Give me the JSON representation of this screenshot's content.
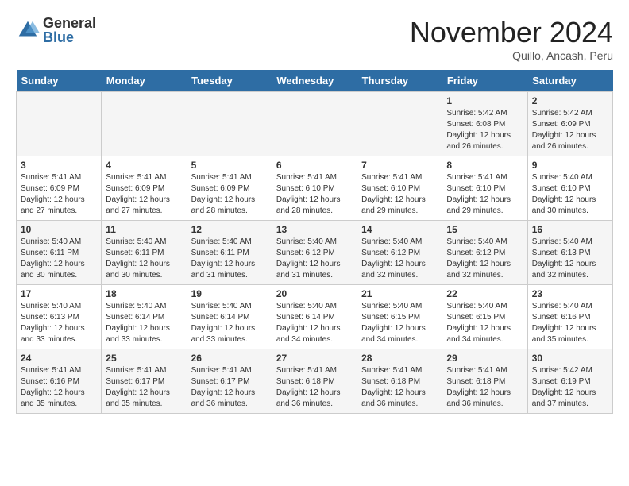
{
  "header": {
    "logo_general": "General",
    "logo_blue": "Blue",
    "title": "November 2024",
    "subtitle": "Quillo, Ancash, Peru"
  },
  "days_of_week": [
    "Sunday",
    "Monday",
    "Tuesday",
    "Wednesday",
    "Thursday",
    "Friday",
    "Saturday"
  ],
  "weeks": [
    [
      {
        "day": "",
        "info": ""
      },
      {
        "day": "",
        "info": ""
      },
      {
        "day": "",
        "info": ""
      },
      {
        "day": "",
        "info": ""
      },
      {
        "day": "",
        "info": ""
      },
      {
        "day": "1",
        "info": "Sunrise: 5:42 AM\nSunset: 6:08 PM\nDaylight: 12 hours and 26 minutes."
      },
      {
        "day": "2",
        "info": "Sunrise: 5:42 AM\nSunset: 6:09 PM\nDaylight: 12 hours and 26 minutes."
      }
    ],
    [
      {
        "day": "3",
        "info": "Sunrise: 5:41 AM\nSunset: 6:09 PM\nDaylight: 12 hours and 27 minutes."
      },
      {
        "day": "4",
        "info": "Sunrise: 5:41 AM\nSunset: 6:09 PM\nDaylight: 12 hours and 27 minutes."
      },
      {
        "day": "5",
        "info": "Sunrise: 5:41 AM\nSunset: 6:09 PM\nDaylight: 12 hours and 28 minutes."
      },
      {
        "day": "6",
        "info": "Sunrise: 5:41 AM\nSunset: 6:10 PM\nDaylight: 12 hours and 28 minutes."
      },
      {
        "day": "7",
        "info": "Sunrise: 5:41 AM\nSunset: 6:10 PM\nDaylight: 12 hours and 29 minutes."
      },
      {
        "day": "8",
        "info": "Sunrise: 5:41 AM\nSunset: 6:10 PM\nDaylight: 12 hours and 29 minutes."
      },
      {
        "day": "9",
        "info": "Sunrise: 5:40 AM\nSunset: 6:10 PM\nDaylight: 12 hours and 30 minutes."
      }
    ],
    [
      {
        "day": "10",
        "info": "Sunrise: 5:40 AM\nSunset: 6:11 PM\nDaylight: 12 hours and 30 minutes."
      },
      {
        "day": "11",
        "info": "Sunrise: 5:40 AM\nSunset: 6:11 PM\nDaylight: 12 hours and 30 minutes."
      },
      {
        "day": "12",
        "info": "Sunrise: 5:40 AM\nSunset: 6:11 PM\nDaylight: 12 hours and 31 minutes."
      },
      {
        "day": "13",
        "info": "Sunrise: 5:40 AM\nSunset: 6:12 PM\nDaylight: 12 hours and 31 minutes."
      },
      {
        "day": "14",
        "info": "Sunrise: 5:40 AM\nSunset: 6:12 PM\nDaylight: 12 hours and 32 minutes."
      },
      {
        "day": "15",
        "info": "Sunrise: 5:40 AM\nSunset: 6:12 PM\nDaylight: 12 hours and 32 minutes."
      },
      {
        "day": "16",
        "info": "Sunrise: 5:40 AM\nSunset: 6:13 PM\nDaylight: 12 hours and 32 minutes."
      }
    ],
    [
      {
        "day": "17",
        "info": "Sunrise: 5:40 AM\nSunset: 6:13 PM\nDaylight: 12 hours and 33 minutes."
      },
      {
        "day": "18",
        "info": "Sunrise: 5:40 AM\nSunset: 6:14 PM\nDaylight: 12 hours and 33 minutes."
      },
      {
        "day": "19",
        "info": "Sunrise: 5:40 AM\nSunset: 6:14 PM\nDaylight: 12 hours and 33 minutes."
      },
      {
        "day": "20",
        "info": "Sunrise: 5:40 AM\nSunset: 6:14 PM\nDaylight: 12 hours and 34 minutes."
      },
      {
        "day": "21",
        "info": "Sunrise: 5:40 AM\nSunset: 6:15 PM\nDaylight: 12 hours and 34 minutes."
      },
      {
        "day": "22",
        "info": "Sunrise: 5:40 AM\nSunset: 6:15 PM\nDaylight: 12 hours and 34 minutes."
      },
      {
        "day": "23",
        "info": "Sunrise: 5:40 AM\nSunset: 6:16 PM\nDaylight: 12 hours and 35 minutes."
      }
    ],
    [
      {
        "day": "24",
        "info": "Sunrise: 5:41 AM\nSunset: 6:16 PM\nDaylight: 12 hours and 35 minutes."
      },
      {
        "day": "25",
        "info": "Sunrise: 5:41 AM\nSunset: 6:17 PM\nDaylight: 12 hours and 35 minutes."
      },
      {
        "day": "26",
        "info": "Sunrise: 5:41 AM\nSunset: 6:17 PM\nDaylight: 12 hours and 36 minutes."
      },
      {
        "day": "27",
        "info": "Sunrise: 5:41 AM\nSunset: 6:18 PM\nDaylight: 12 hours and 36 minutes."
      },
      {
        "day": "28",
        "info": "Sunrise: 5:41 AM\nSunset: 6:18 PM\nDaylight: 12 hours and 36 minutes."
      },
      {
        "day": "29",
        "info": "Sunrise: 5:41 AM\nSunset: 6:18 PM\nDaylight: 12 hours and 36 minutes."
      },
      {
        "day": "30",
        "info": "Sunrise: 5:42 AM\nSunset: 6:19 PM\nDaylight: 12 hours and 37 minutes."
      }
    ]
  ]
}
